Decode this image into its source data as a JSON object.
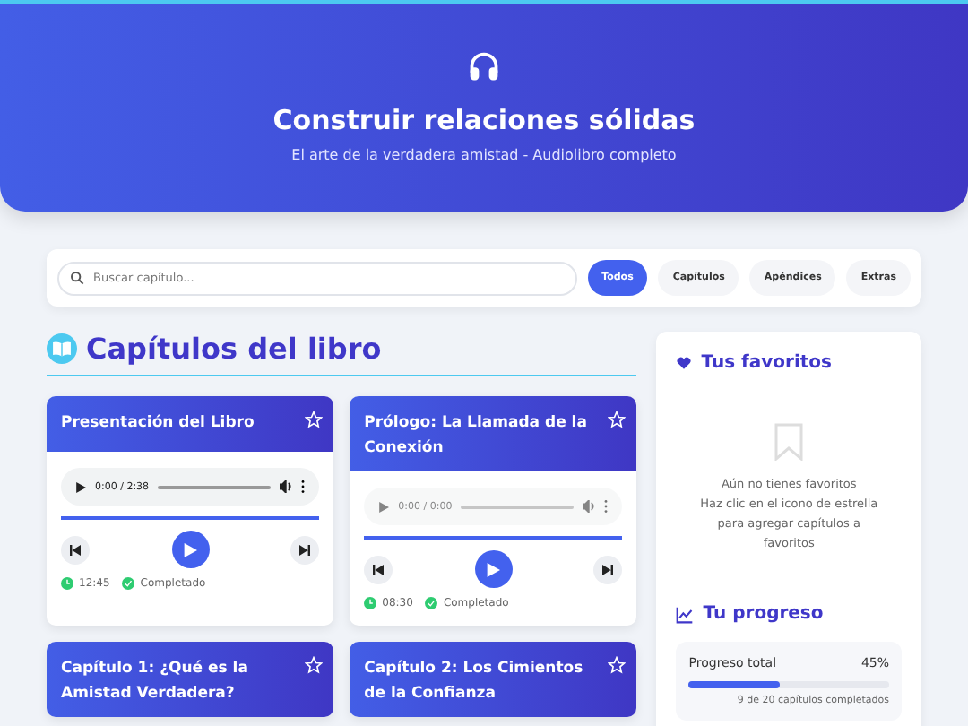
{
  "header": {
    "title": "Construir relaciones sólidas",
    "subtitle": "El arte de la verdadera amistad - Audiolibro completo"
  },
  "search": {
    "placeholder": "Buscar capítulo..."
  },
  "filters": [
    {
      "label": "Todos",
      "selected": true
    },
    {
      "label": "Capítulos",
      "selected": false
    },
    {
      "label": "Apéndices",
      "selected": false
    },
    {
      "label": "Extras",
      "selected": false
    }
  ],
  "section_title": "Capítulos del libro",
  "chapters": [
    {
      "title": "Presentación del Libro",
      "favorite": false,
      "player": {
        "time": "0:00 / 2:38",
        "disabled": false
      },
      "duration": "12:45",
      "status": "Completado",
      "completed": true
    },
    {
      "title": "Prólogo: La Llamada de la Conexión",
      "favorite": false,
      "player": {
        "time": "0:00 / 0:00",
        "disabled": true
      },
      "duration": "08:30",
      "status": "Completado",
      "completed": true
    },
    {
      "title": "Capítulo 1: ¿Qué es la Amistad Verdadera?",
      "favorite": false
    },
    {
      "title": "Capítulo 2: Los Cimientos de la Confianza",
      "favorite": false
    }
  ],
  "favorites": {
    "title": "Tus favoritos",
    "empty_lines": [
      "Aún no tienes favoritos",
      "Haz clic en el icono de estrella para agregar capítulos a favoritos"
    ]
  },
  "progress": {
    "title": "Tu progreso",
    "label": "Progreso total",
    "percent": "45%",
    "level": 0.45,
    "caption": "9 de 20 capítulos completados"
  }
}
